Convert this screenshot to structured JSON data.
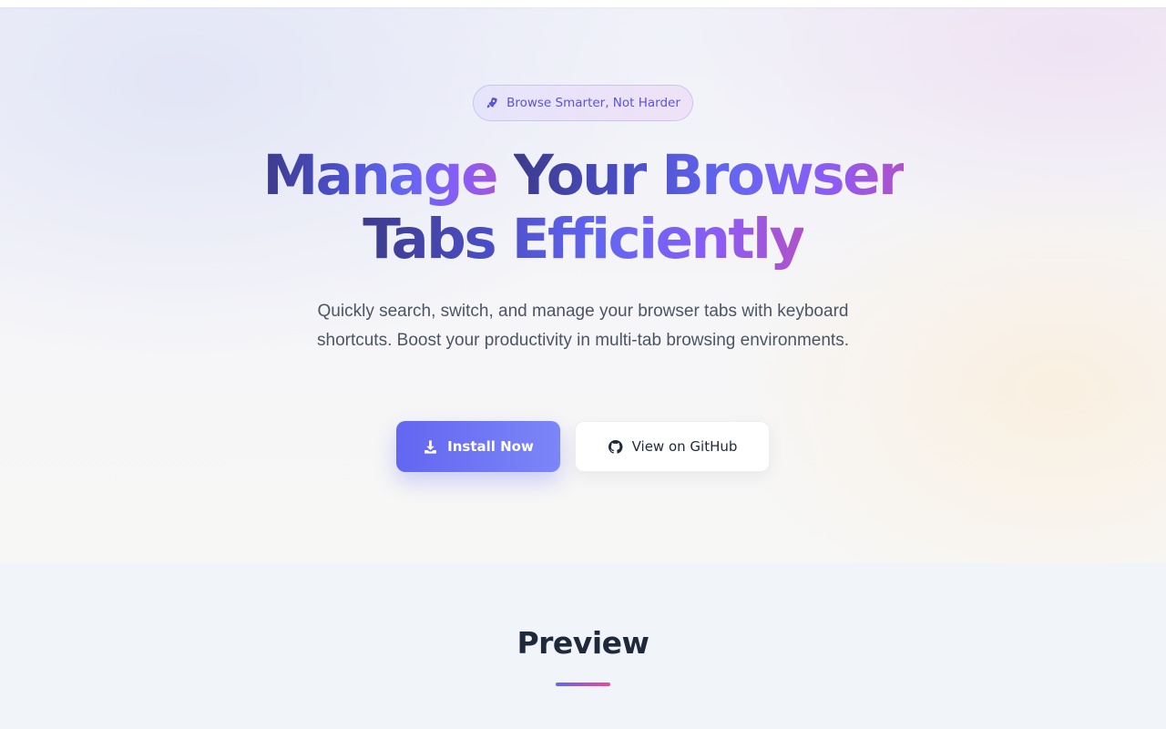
{
  "hero": {
    "badge": {
      "icon": "rocket-icon",
      "label": "Browse Smarter, Not Harder"
    },
    "headline": {
      "line1_part1": "Manage ",
      "line1_part2": "Your Browser",
      "line2": "Tabs Efficiently"
    },
    "subtitle": "Quickly search, switch, and manage your browser tabs with keyboard shortcuts. Boost your productivity in multi-tab browsing environments.",
    "primary_button": {
      "icon": "download-icon",
      "label": "Install Now"
    },
    "secondary_button": {
      "icon": "github-icon",
      "label": "View on GitHub"
    }
  },
  "preview": {
    "title": "Preview"
  },
  "colors": {
    "accent": "#6366f1",
    "accent_purple": "#8b5cf6",
    "accent_pink": "#ec4899",
    "heading_dark": "#1e293b",
    "text_muted": "#4b5563"
  }
}
